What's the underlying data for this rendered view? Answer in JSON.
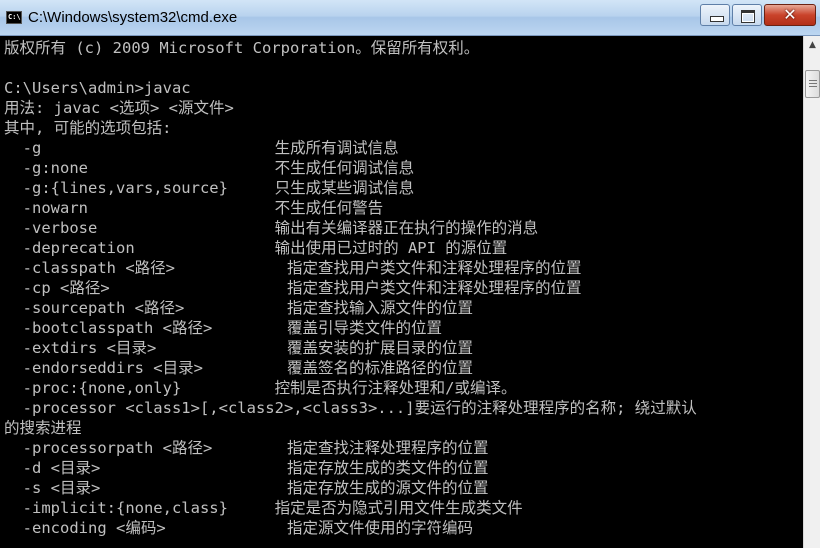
{
  "window": {
    "title": "C:\\Windows\\system32\\cmd.exe",
    "icon_label": "C:\\",
    "controls": {
      "minimize": "minimize",
      "maximize": "maximize",
      "close": "✕"
    }
  },
  "console": {
    "lines": [
      "版权所有 (c) 2009 Microsoft Corporation。保留所有权利。",
      "",
      "C:\\Users\\admin>javac",
      "用法: javac <选项> <源文件>",
      "其中, 可能的选项包括:",
      "  -g                         生成所有调试信息",
      "  -g:none                    不生成任何调试信息",
      "  -g:{lines,vars,source}     只生成某些调试信息",
      "  -nowarn                    不生成任何警告",
      "  -verbose                   输出有关编译器正在执行的操作的消息",
      "  -deprecation               输出使用已过时的 API 的源位置",
      "  -classpath <路径>            指定查找用户类文件和注释处理程序的位置",
      "  -cp <路径>                   指定查找用户类文件和注释处理程序的位置",
      "  -sourcepath <路径>           指定查找输入源文件的位置",
      "  -bootclasspath <路径>        覆盖引导类文件的位置",
      "  -extdirs <目录>              覆盖安装的扩展目录的位置",
      "  -endorseddirs <目录>         覆盖签名的标准路径的位置",
      "  -proc:{none,only}          控制是否执行注释处理和/或编译。",
      "  -processor <class1>[,<class2>,<class3>...]要运行的注释处理程序的名称; 绕过默认",
      "的搜索进程",
      "  -processorpath <路径>        指定查找注释处理程序的位置",
      "  -d <目录>                    指定存放生成的类文件的位置",
      "  -s <目录>                    指定存放生成的源文件的位置",
      "  -implicit:{none,class}     指定是否为隐式引用文件生成类文件",
      "  -encoding <编码>             指定源文件使用的字符编码"
    ]
  }
}
